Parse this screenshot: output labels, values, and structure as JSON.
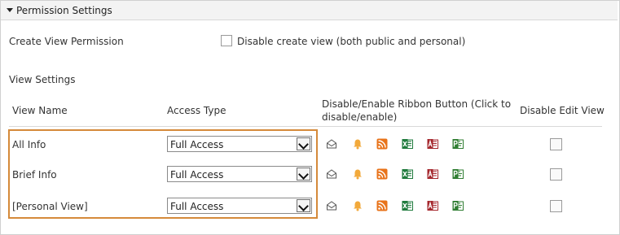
{
  "section": {
    "title": "Permission Settings"
  },
  "create_view": {
    "label": "Create View Permission",
    "checkbox_label": "Disable create view (both public and personal)"
  },
  "view_settings": {
    "title": "View Settings",
    "columns": {
      "view_name": "View Name",
      "access_type": "Access Type",
      "ribbon_line1": "Disable/Enable Ribbon Button (Click to",
      "ribbon_line2": "disable/enable)",
      "disable_edit": "Disable Edit View"
    },
    "rows": [
      {
        "name": "All Info",
        "access": "Full Access"
      },
      {
        "name": "Brief Info",
        "access": "Full Access"
      },
      {
        "name": "[Personal View]",
        "access": "Full Access"
      }
    ],
    "ribbon_icons": [
      "email-icon",
      "alert-bell-icon",
      "rss-feed-icon",
      "excel-icon",
      "access-icon",
      "project-icon"
    ]
  },
  "colors": {
    "highlight": "#d58a3a",
    "bell": "#f2a93b",
    "rss": "#e8731a",
    "excel": "#1e7a3c",
    "access": "#a4262c",
    "project": "#2f7d32"
  }
}
